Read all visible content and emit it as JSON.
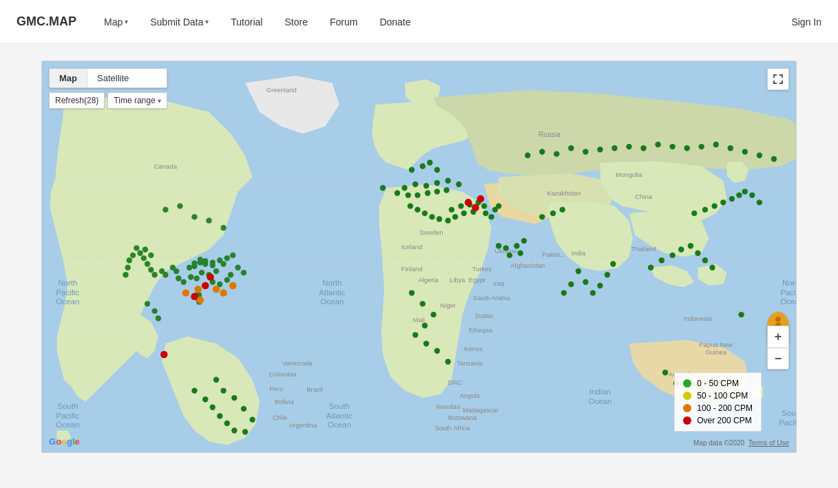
{
  "brand": "GMC.MAP",
  "nav": {
    "links": [
      {
        "label": "Map",
        "hasDropdown": true
      },
      {
        "label": "Submit Data",
        "hasDropdown": true
      },
      {
        "label": "Tutorial",
        "hasDropdown": false
      },
      {
        "label": "Store",
        "hasDropdown": false
      },
      {
        "label": "Forum",
        "hasDropdown": false
      },
      {
        "label": "Donate",
        "hasDropdown": false
      }
    ],
    "signin_label": "Sign In"
  },
  "map": {
    "type_buttons": [
      "Map",
      "Satellite"
    ],
    "active_type": "Map",
    "refresh_label": "Refresh(28)",
    "time_range_label": "Time range",
    "fullscreen_icon": "⤢",
    "zoom_in_label": "+",
    "zoom_out_label": "−",
    "google_label": "Google",
    "map_data_label": "Map data ©2020",
    "terms_label": "Terms of Use",
    "legend": [
      {
        "label": "0 - 50 CPM",
        "color": "#22aa22"
      },
      {
        "label": "50 - 100 CPM",
        "color": "#cccc00"
      },
      {
        "label": "100 - 200 CPM",
        "color": "#e07800"
      },
      {
        "label": "Over 200 CPM",
        "color": "#cc0000"
      }
    ]
  }
}
